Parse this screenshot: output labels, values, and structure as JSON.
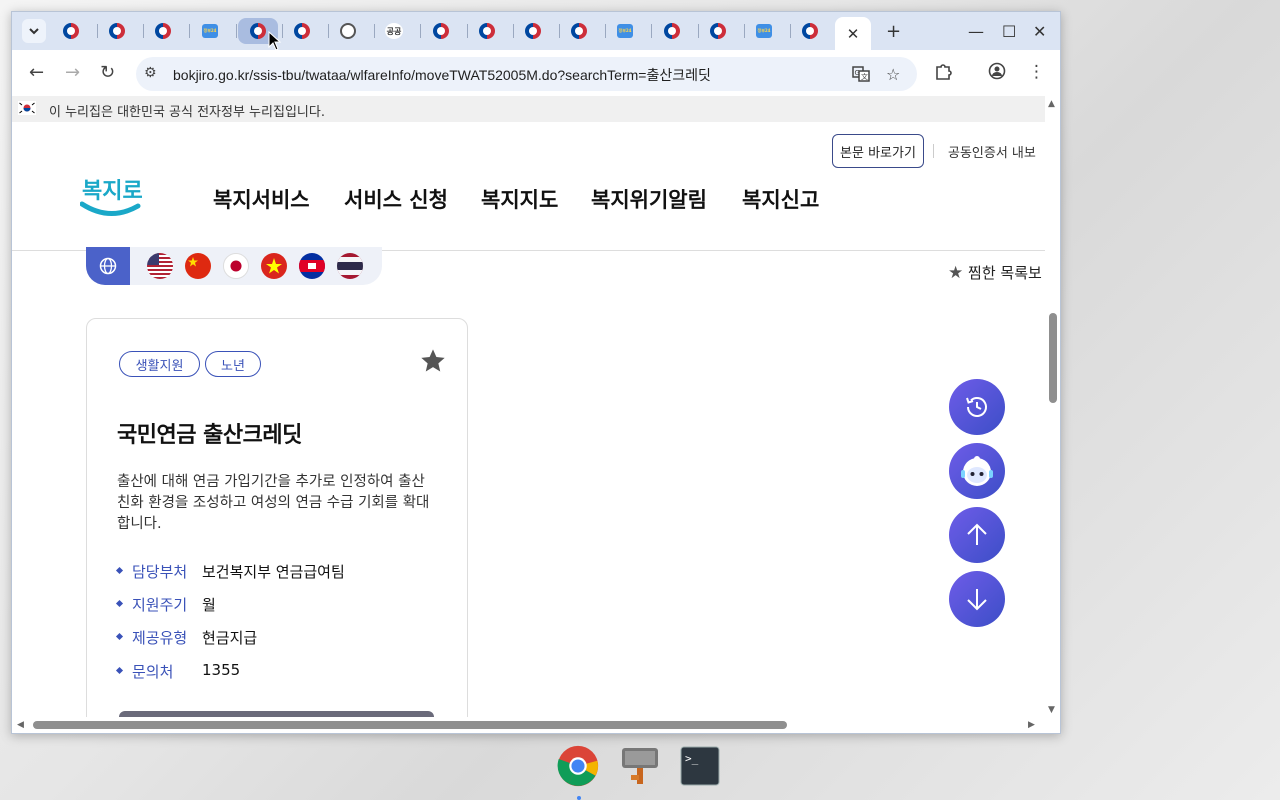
{
  "browser": {
    "url": "bokjiro.go.kr/ssis-tbu/twataa/wlfareInfo/moveTWAT52005M.do?searchTerm=출산크레딧",
    "tabs": [
      {
        "icon": "taeguk-icon"
      },
      {
        "icon": "taeguk-icon"
      },
      {
        "icon": "taeguk-icon"
      },
      {
        "icon": "gov24-icon"
      },
      {
        "icon": "taeguk-icon"
      },
      {
        "icon": "taeguk-icon"
      },
      {
        "icon": "globe-icon"
      },
      {
        "icon": "text-icon",
        "text": "공공"
      },
      {
        "icon": "taeguk-icon"
      },
      {
        "icon": "taeguk-icon"
      },
      {
        "icon": "taeguk-icon"
      },
      {
        "icon": "taeguk-icon"
      },
      {
        "icon": "gov24-icon"
      },
      {
        "icon": "taeguk-icon"
      },
      {
        "icon": "taeguk-icon"
      },
      {
        "icon": "gov24-icon"
      },
      {
        "icon": "taeguk-icon"
      }
    ],
    "gov24_label": "정부24"
  },
  "page": {
    "gov_banner": "이 누리집은 대한민국 공식 전자정부 누리집입니다.",
    "skip_link": "본문 바로가기",
    "cert_link": "공동인증서 내보",
    "logo_text": "복지로",
    "nav": [
      "복지서비스",
      "서비스 신청",
      "복지지도",
      "복지위기알림",
      "복지신고"
    ],
    "languages": [
      "English",
      "中文",
      "日本語",
      "Tiếng Việt",
      "ខ្មែរ",
      "ไทย"
    ],
    "favorite_list": "찜한 목록보",
    "card": {
      "tags": [
        "생활지원",
        "노년"
      ],
      "title": "국민연금 출산크레딧",
      "description": "출산에 대해 연금 가입기간을 추가로 인정하여 출산 친화 환경을 조성하고 여성의 연금 수급 기회를 확대합니다.",
      "info": [
        {
          "label": "담당부처",
          "value": "보건복지부 연금급여팀"
        },
        {
          "label": "지원주기",
          "value": "월"
        },
        {
          "label": "제공유형",
          "value": "현금지급"
        },
        {
          "label": "문의처",
          "value": "1355"
        }
      ]
    }
  },
  "colors": {
    "brand_blue": "#3a52b8",
    "float_button": "#4f55d8",
    "tabstrip": "#dbe4f3"
  }
}
